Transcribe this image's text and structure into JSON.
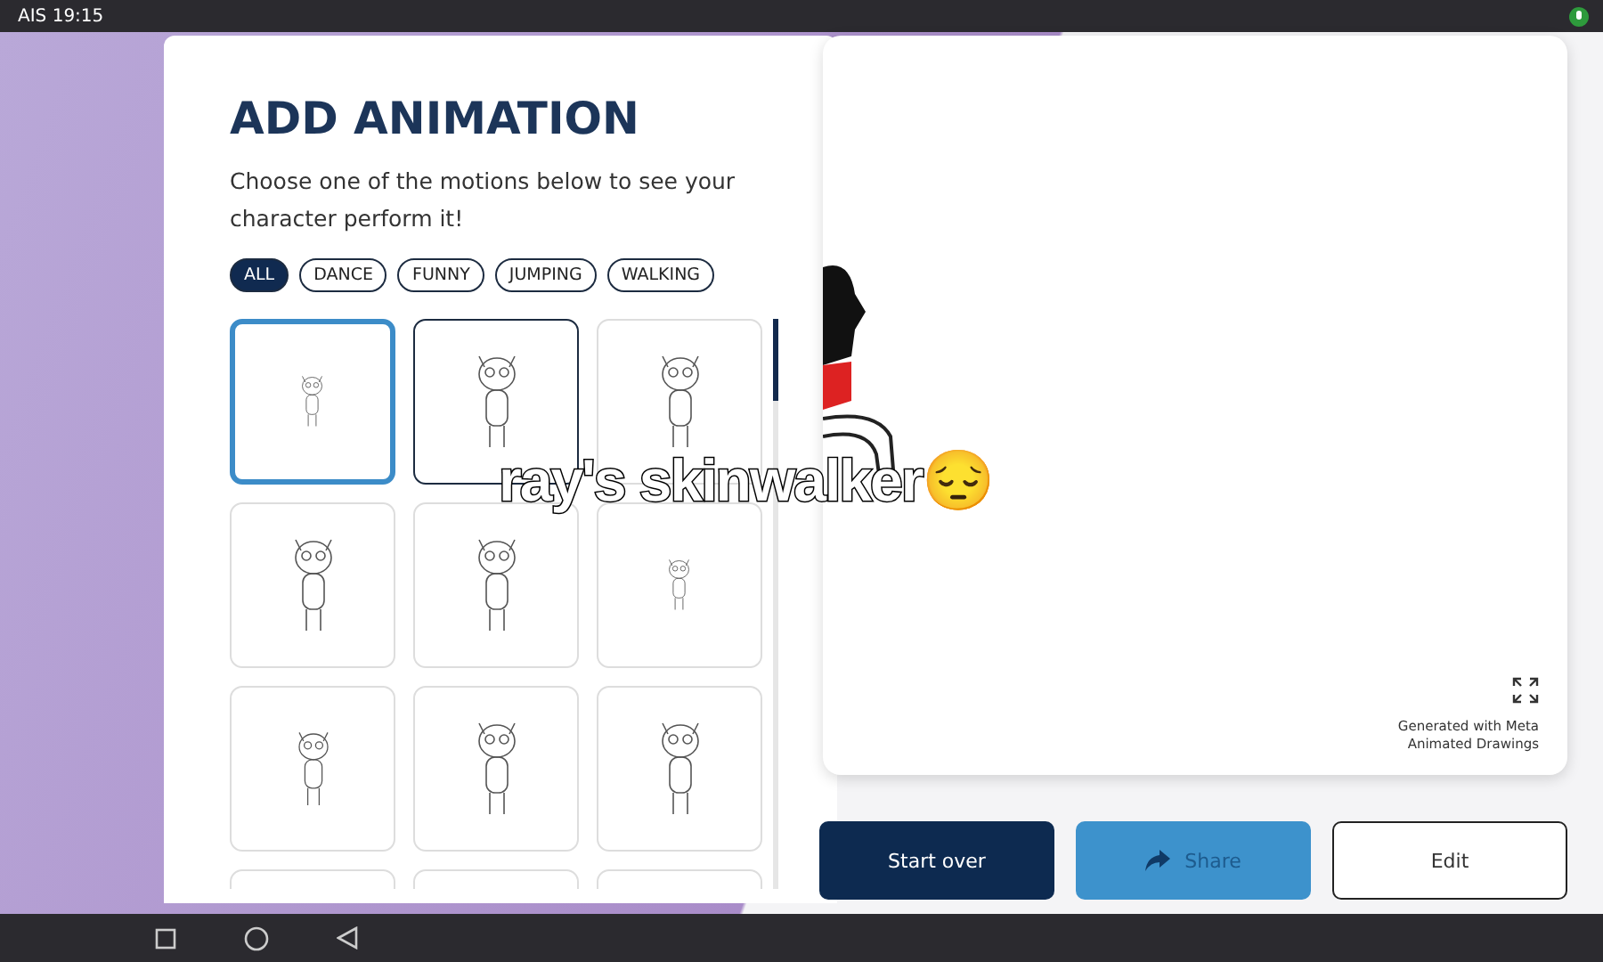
{
  "status_bar": {
    "carrier": "AIS",
    "time": "19:15"
  },
  "panel": {
    "title": "ADD ANIMATION",
    "description": "Choose one of the motions below to see your character perform it!",
    "filters": [
      {
        "label": "ALL",
        "selected": true
      },
      {
        "label": "DANCE",
        "selected": false
      },
      {
        "label": "FUNNY",
        "selected": false
      },
      {
        "label": "JUMPING",
        "selected": false
      },
      {
        "label": "WALKING",
        "selected": false
      }
    ],
    "motions": [
      {
        "selected": true,
        "highlighted": false
      },
      {
        "selected": false,
        "highlighted": true
      },
      {
        "selected": false,
        "highlighted": false
      },
      {
        "selected": false,
        "highlighted": false
      },
      {
        "selected": false,
        "highlighted": false
      },
      {
        "selected": false,
        "highlighted": false
      },
      {
        "selected": false,
        "highlighted": false
      },
      {
        "selected": false,
        "highlighted": false
      },
      {
        "selected": false,
        "highlighted": false
      },
      {
        "selected": false,
        "highlighted": false
      },
      {
        "selected": false,
        "highlighted": false
      },
      {
        "selected": false,
        "highlighted": false
      }
    ]
  },
  "preview": {
    "credit": "Generated with Meta Animated Drawings"
  },
  "buttons": [
    {
      "label": "Start over",
      "kind": "primary"
    },
    {
      "label": "Share",
      "kind": "share"
    },
    {
      "label": "Edit",
      "kind": "outline"
    }
  ],
  "caption": "ray's skinwalker😔"
}
